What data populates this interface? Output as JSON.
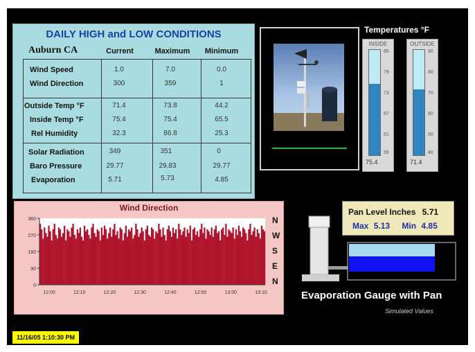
{
  "conditions": {
    "title": "DAILY  HIGH  and LOW CONDITIONS",
    "location": "Auburn CA",
    "columns": [
      "Current",
      "Maximum",
      "Minimum"
    ],
    "rows": [
      {
        "label": "Wind Speed",
        "current": "1.0",
        "maximum": "7.0",
        "minimum": "0.0"
      },
      {
        "label": "Wind Direction",
        "current": "300",
        "maximum": "359",
        "minimum": "1"
      },
      {
        "label": "Outside Temp °F",
        "current": "71.4",
        "maximum": "73.8",
        "minimum": "44.2"
      },
      {
        "label": "Inside Temp °F",
        "current": "75.4",
        "maximum": "75.4",
        "minimum": "65.5"
      },
      {
        "label": "Rel Humidity",
        "current": "32.3",
        "maximum": "86.8",
        "minimum": "25.3"
      },
      {
        "label": "Solar Radiation",
        "current": "349",
        "maximum": "351",
        "minimum": "0"
      },
      {
        "label": "Baro Pressure",
        "current": "29.77",
        "maximum": "29.83",
        "minimum": "29.77"
      },
      {
        "label": "Evaporation",
        "current": "5.71",
        "maximum": "5.73",
        "minimum": "4.85"
      }
    ]
  },
  "temperatures": {
    "title": "Temperatures °F",
    "inside": {
      "label": "INSIDE",
      "reading": "75.4",
      "value": 75.4,
      "min": 55,
      "max": 85,
      "ticks": [
        "85",
        "79",
        "73",
        "67",
        "61",
        "55"
      ]
    },
    "outside": {
      "label": "OUTSIDE",
      "reading": "71.4",
      "value": 71.4,
      "min": 40,
      "max": 90,
      "ticks": [
        "90",
        "80",
        "70",
        "60",
        "50",
        "40"
      ]
    }
  },
  "wind": {
    "title": "Wind Direction",
    "directions": [
      "N",
      "W",
      "S",
      "E",
      "N"
    ]
  },
  "chart_data": {
    "type": "bar",
    "title": "Wind Direction",
    "xlabel": "",
    "ylabel": "",
    "ylim": [
      0,
      360
    ],
    "yticks": [
      "360",
      "270",
      "180",
      "90",
      "0"
    ],
    "xticks": [
      "12:00",
      "12:10",
      "12:20",
      "12:30",
      "12:40",
      "12:50",
      "13:00",
      "13:10"
    ],
    "series": [
      {
        "values": [
          330,
          300,
          250,
          310,
          280,
          260,
          320,
          290,
          240,
          300,
          330,
          270,
          250,
          310,
          300,
          260,
          280,
          320,
          240,
          300,
          290,
          260,
          310,
          330,
          270,
          250,
          300,
          280,
          310,
          260,
          240,
          320,
          290,
          300,
          270,
          250,
          310,
          330,
          280,
          260,
          300,
          290,
          240,
          310,
          270,
          320,
          300,
          250,
          280,
          310,
          260,
          300,
          330,
          270,
          290,
          250,
          310,
          300,
          240,
          280,
          320,
          260,
          300,
          290,
          310,
          250,
          270,
          330,
          300,
          260,
          280,
          310,
          290,
          240,
          300,
          320,
          270,
          260,
          310,
          300,
          250,
          290,
          280,
          330,
          300,
          260,
          310,
          270,
          240,
          300,
          320,
          290,
          260,
          310,
          280,
          300,
          250,
          330,
          300,
          270,
          290,
          310,
          260,
          300,
          280,
          320,
          240,
          300,
          310,
          270,
          290,
          260,
          300,
          330,
          280,
          310,
          250,
          300,
          290,
          270,
          310,
          260,
          300,
          320,
          280,
          290,
          240,
          300,
          310,
          270,
          330,
          260,
          300,
          290,
          280,
          310,
          250,
          300,
          270,
          320,
          290,
          260,
          310,
          300,
          280,
          240,
          300,
          330,
          270,
          290,
          310,
          260,
          300,
          280,
          250,
          320,
          300,
          290
        ]
      }
    ]
  },
  "evaporation": {
    "pan_level_label": "Pan Level Inches",
    "pan_level_value": "5.71",
    "max_label": "Max",
    "max_value": "5.13",
    "min_label": "Min",
    "min_value": "4.85",
    "title": "Evaporation Gauge with Pan",
    "note": "Simulated Values",
    "pan_fill": 0.55
  },
  "timestamp": "11/16/05 1:10:30 PM",
  "colors": {
    "bar": "#b0142c",
    "pan_water": "#1010f0",
    "thermo_fill": "#2f86c0"
  }
}
